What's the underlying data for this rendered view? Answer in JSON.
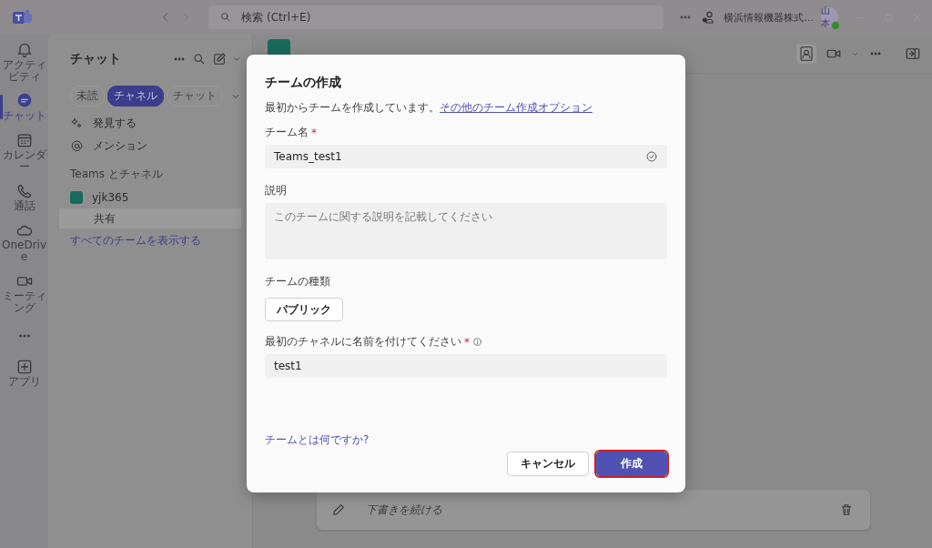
{
  "title_bar": {
    "search": {
      "placeholder": "検索 (Ctrl+E)"
    },
    "org_name": "横浜情報機器株式...",
    "avatar": {
      "initials": "山本"
    }
  },
  "rail": [
    {
      "kind": "bell",
      "label": "アクティビティ",
      "selected": false
    },
    {
      "kind": "chat",
      "label": "チャット",
      "selected": true
    },
    {
      "kind": "calendar",
      "label": "カレンダー",
      "selected": false
    },
    {
      "kind": "phone",
      "label": "通話",
      "selected": false
    },
    {
      "kind": "cloud",
      "label": "OneDrive",
      "selected": false
    },
    {
      "kind": "video",
      "label": "ミーティング",
      "selected": false
    },
    {
      "kind": "more"
    },
    {
      "kind": "apps",
      "label": "アプリ",
      "selected": false
    }
  ],
  "chat_panel": {
    "title": "チャット",
    "filters": [
      {
        "label": "未読",
        "selected": false
      },
      {
        "label": "チャネル",
        "selected": true
      },
      {
        "label": "チャット",
        "selected": false
      }
    ],
    "items": [
      {
        "kind": "discover",
        "label": "発見する"
      },
      {
        "kind": "mention",
        "label": "メンション"
      }
    ],
    "section": "Teams とチャネル",
    "teams": [
      {
        "name": "yjk365",
        "children": [
          {
            "name": "共有",
            "selected": true
          }
        ]
      }
    ],
    "show_all": "すべてのチームを表示する"
  },
  "draft": {
    "text": "下書きを続ける"
  },
  "dialog": {
    "title": "チームの作成",
    "subtitle": "最初からチームを作成しています。",
    "subtitle_link": "その他のチーム作成オプション",
    "fields": [
      {
        "kind": "text",
        "label": "チーム名",
        "required_mark": "*",
        "value": "Teams_test1",
        "valid": true
      },
      {
        "kind": "textarea",
        "label": "説明",
        "placeholder": "このチームに関する説明を記載してください"
      },
      {
        "kind": "choice",
        "label": "チームの種類",
        "value": "パブリック"
      },
      {
        "kind": "text",
        "label": "最初のチャネルに名前を付けてください",
        "required_mark": "*",
        "info": true,
        "value": "test1",
        "valid": false
      }
    ],
    "help_link": "チームとは何ですか?",
    "buttons": [
      {
        "kind": "secondary",
        "label": "キャンセル",
        "highlighted": false
      },
      {
        "kind": "primary",
        "label": "作成",
        "highlighted": true
      }
    ]
  }
}
